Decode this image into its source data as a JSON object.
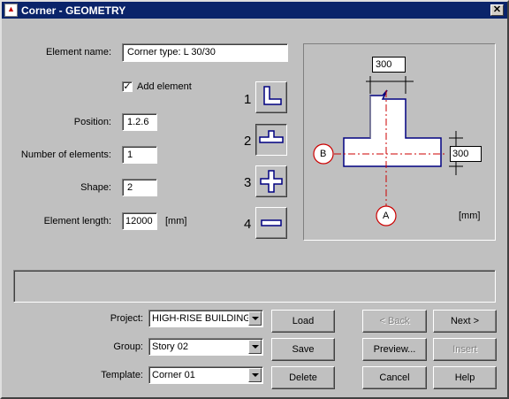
{
  "window": {
    "title": "Corner - GEOMETRY",
    "close_glyph": "✕"
  },
  "form": {
    "element_name_label": "Element name:",
    "element_name_value": "Corner type: L 30/30",
    "add_element_label": "Add element",
    "add_element_checked": true,
    "position_label": "Position:",
    "position_value": "1.2.6",
    "number_label": "Number of elements:",
    "number_value": "1",
    "shape_label": "Shape:",
    "shape_value": "2",
    "length_label": "Element length:",
    "length_value": "12000",
    "length_unit": "[mm]"
  },
  "shapes": [
    {
      "num": "1",
      "icon": "l-corner-icon"
    },
    {
      "num": "2",
      "icon": "t-corner-icon",
      "selected": true
    },
    {
      "num": "3",
      "icon": "cross-corner-icon"
    },
    {
      "num": "4",
      "icon": "straight-wall-icon"
    }
  ],
  "diagram": {
    "dim_top": "300",
    "dim_right": "300",
    "label_a": "A",
    "label_b": "B",
    "unit": "[mm]"
  },
  "bottom": {
    "project_label": "Project:",
    "project_value": "HIGH-RISE BUILDING",
    "group_label": "Group:",
    "group_value": "Story 02",
    "template_label": "Template:",
    "template_value": "Corner 01",
    "load": "Load",
    "save": "Save",
    "delete": "Delete",
    "back": "< Back",
    "next": "Next  >",
    "preview": "Preview...",
    "insert": "Insert",
    "cancel": "Cancel",
    "help": "Help"
  },
  "colors": {
    "titlebar": "#0a246a",
    "dialog": "#c0c0c0",
    "axis_red": "#cc0000"
  }
}
